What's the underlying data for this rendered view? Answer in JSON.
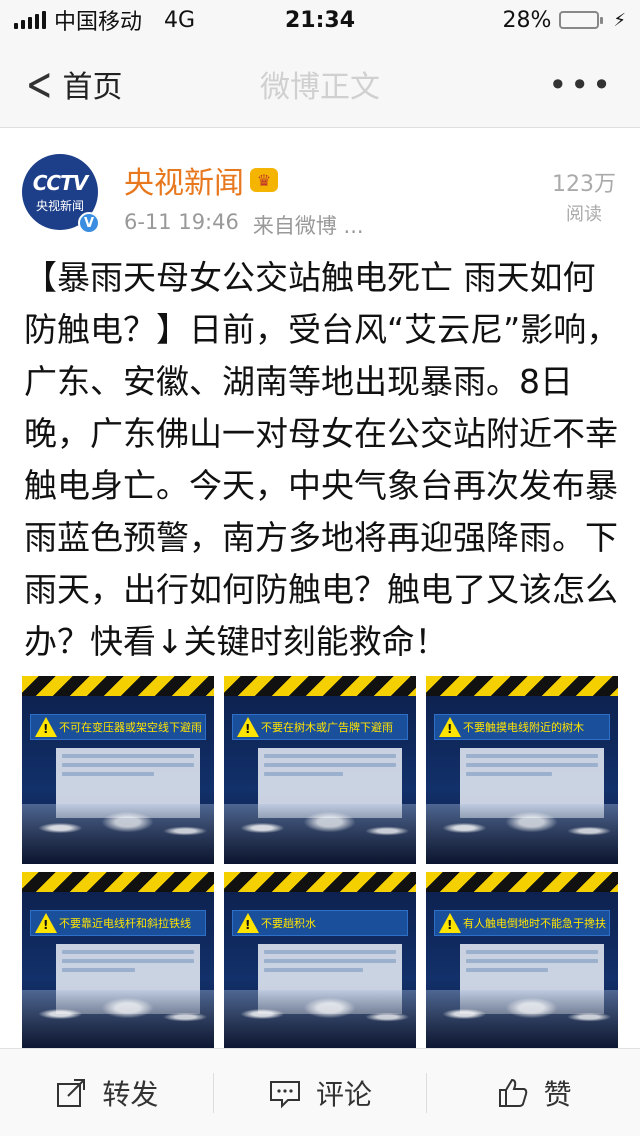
{
  "status": {
    "carrier": "中国移动",
    "network": "4G",
    "time": "21:34",
    "battery": "28%",
    "battery_level": 0.28
  },
  "nav": {
    "back_label": "首页",
    "title": "微博正文",
    "more_label": "•••"
  },
  "post": {
    "avatar_logo": "CCTV",
    "avatar_sub": "央视新闻",
    "author": "央视新闻",
    "time": "6-11 19:46",
    "source": "来自微博 ...",
    "reads_count": "123万",
    "reads_label": "阅读",
    "text": "【暴雨天母女公交站触电死亡 雨天如何防触电？】日前，受台风“艾云尼”影响，广东、安徽、湖南等地出现暴雨。8日晚，广东佛山一对母女在公交站附近不幸触电身亡。今天，中央气象台再次发布暴雨蓝色预警，南方多地将再迎强降雨。下雨天，出行如何防触电？触电了又该怎么办？快看↓关键时刻能救命！"
  },
  "images": [
    {
      "caption": "不可在变压器或架空线下避雨"
    },
    {
      "caption": "不要在树木或广告牌下避雨"
    },
    {
      "caption": "不要触摸电线附近的树木"
    },
    {
      "caption": "不要靠近电线杆和斜拉铁线"
    },
    {
      "caption": "不要趟积水"
    },
    {
      "caption": "有人触电倒地时不能急于搀扶"
    }
  ],
  "toolbar": {
    "repost": "转发",
    "comment": "评论",
    "like": "赞"
  }
}
